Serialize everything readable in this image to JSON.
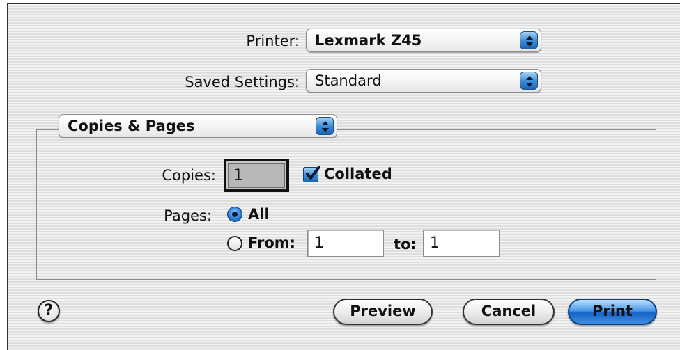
{
  "printer": {
    "label": "Printer:",
    "value": "Lexmark Z45"
  },
  "saved_settings": {
    "label": "Saved Settings:",
    "value": "Standard"
  },
  "panel": {
    "value": "Copies & Pages"
  },
  "copies": {
    "label": "Copies:",
    "value": "1",
    "collated_label": "Collated",
    "collated": true
  },
  "pages": {
    "label": "Pages:",
    "all_label": "All",
    "from_label": "From:",
    "from_value": "1",
    "to_label": "to:",
    "to_value": "1",
    "selected": "All"
  },
  "buttons": {
    "help": "?",
    "preview": "Preview",
    "cancel": "Cancel",
    "print": "Print"
  },
  "icons": {
    "popup_arrows": "up-down-arrows-icon",
    "check": "checkmark-icon"
  },
  "colors": {
    "accent": "#2a7fd6",
    "background_stripe_light": "#f2f2f2",
    "background_stripe_dark": "#dedede"
  }
}
